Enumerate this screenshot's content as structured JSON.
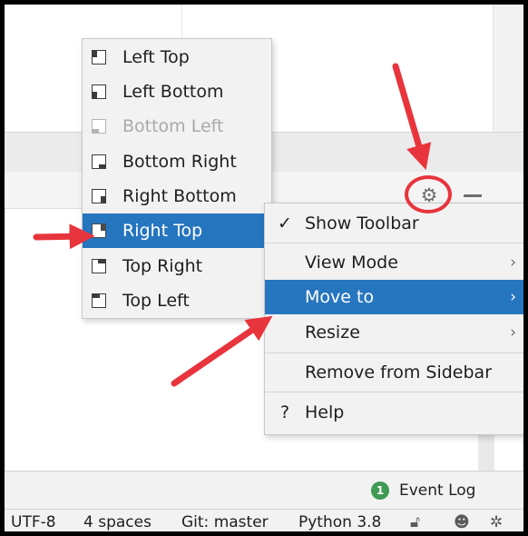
{
  "position_menu": {
    "items": [
      {
        "label": "Left Top",
        "state": "normal"
      },
      {
        "label": "Left Bottom",
        "state": "normal"
      },
      {
        "label": "Bottom Left",
        "state": "disabled"
      },
      {
        "label": "Bottom Right",
        "state": "normal"
      },
      {
        "label": "Right Bottom",
        "state": "normal"
      },
      {
        "label": "Right Top",
        "state": "selected"
      },
      {
        "label": "Top Right",
        "state": "normal"
      },
      {
        "label": "Top Left",
        "state": "normal"
      }
    ]
  },
  "options_menu": {
    "items": [
      {
        "label": "Show Toolbar",
        "lead": "✓",
        "submenu": false
      },
      {
        "label": "View Mode",
        "lead": "",
        "submenu": true
      },
      {
        "label": "Move to",
        "lead": "",
        "submenu": true,
        "selected": true
      },
      {
        "label": "Resize",
        "lead": "",
        "submenu": true
      },
      {
        "label": "Remove from Sidebar",
        "lead": "",
        "submenu": false
      },
      {
        "label": "Help",
        "lead": "?",
        "submenu": false
      }
    ],
    "chevron": "›"
  },
  "toolbar": {
    "gear_icon": "gear-icon",
    "hide_icon": "minus-icon"
  },
  "event_log": {
    "count": "1",
    "label": "Event Log"
  },
  "status_bar": {
    "encoding": "UTF-8",
    "indent": "4 spaces",
    "vcs": "Git: master",
    "interpreter": "Python 3.8"
  },
  "colors": {
    "selection": "#2675bf",
    "annotation": "#e8343c",
    "badge": "#3f9a54"
  }
}
